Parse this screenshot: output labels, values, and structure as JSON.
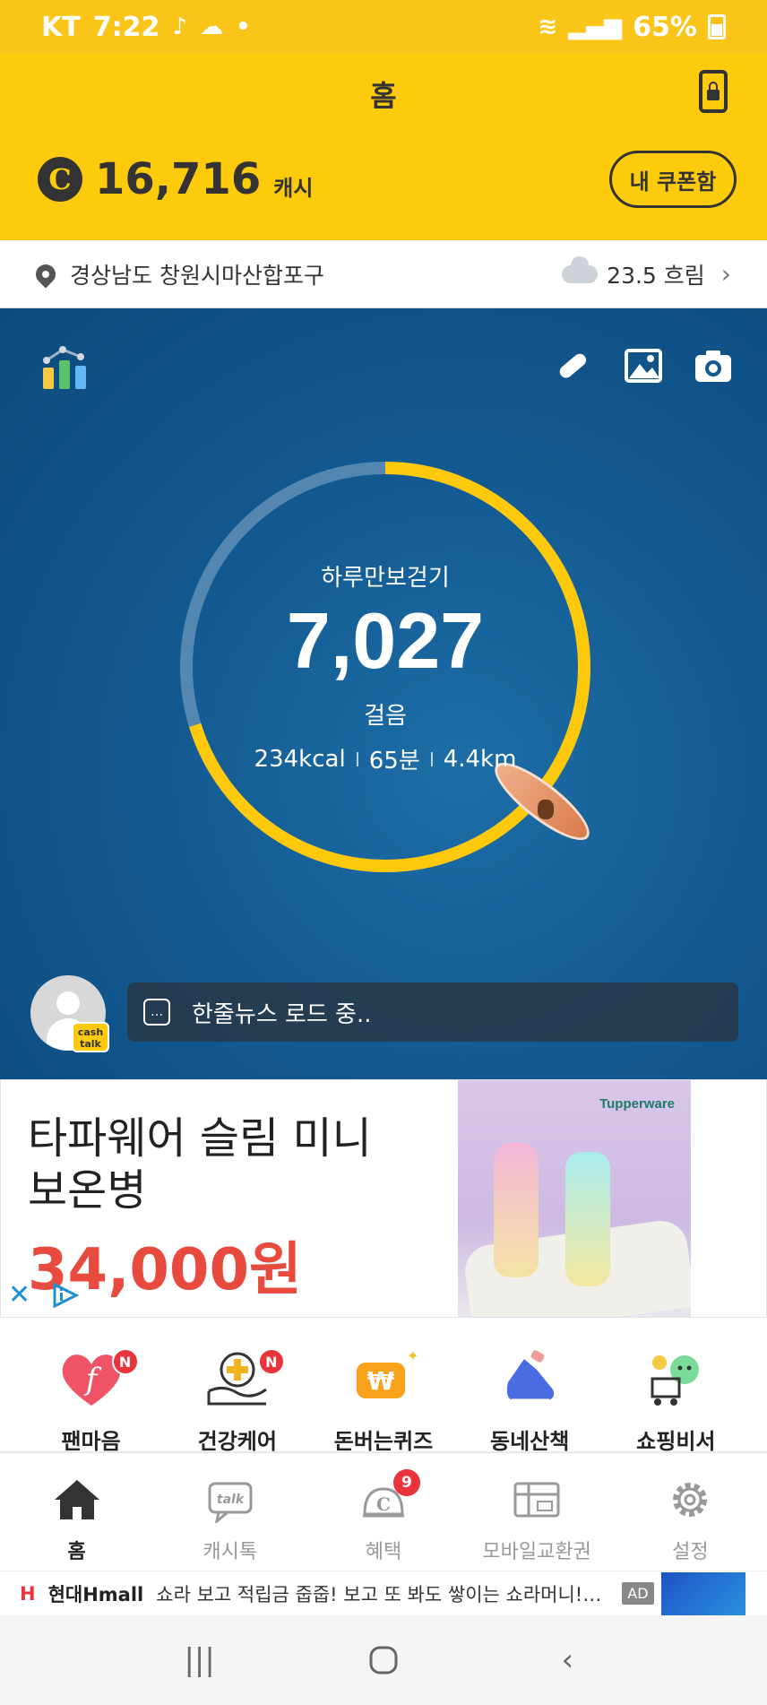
{
  "status_bar": {
    "carrier": "KT",
    "time": "7:22",
    "battery": "65%"
  },
  "header": {
    "title": "홈",
    "cash_amount": "16,716",
    "cash_unit": "캐시",
    "coupon_button": "내 쿠폰함",
    "coin_letter": "C"
  },
  "location": {
    "address": "경상남도 창원시마산합포구",
    "temperature_weather": "23.5 흐림"
  },
  "hero": {
    "title": "하루만보걷기",
    "steps": "7,027",
    "steps_unit": "걸음",
    "kcal": "234kcal",
    "minutes": "65분",
    "distance": "4.4km",
    "progress_fraction": 0.7027,
    "news_text": "한줄뉴스 로드 중..",
    "cashtalk_badge": "cash talk"
  },
  "ad": {
    "product_text": "타파웨어 슬림 미니 보온병",
    "price": "34,000원",
    "brand": "Tupperware"
  },
  "menu": {
    "items": [
      {
        "label": "팬마음",
        "badge": "N",
        "icon": "heart-f-icon"
      },
      {
        "label": "건강케어",
        "badge": "N",
        "icon": "health-care-icon"
      },
      {
        "label": "돈버는퀴즈",
        "badge": "",
        "icon": "quiz-icon"
      },
      {
        "label": "동네산책",
        "badge": "",
        "icon": "sneaker-icon"
      },
      {
        "label": "쇼핑비서",
        "badge": "",
        "icon": "shopping-assistant-icon"
      }
    ]
  },
  "bottom_nav": {
    "items": [
      {
        "label": "홈",
        "icon": "home-icon"
      },
      {
        "label": "캐시톡",
        "icon": "talk-icon"
      },
      {
        "label": "혜택",
        "icon": "benefit-icon",
        "badge": "9"
      },
      {
        "label": "모바일교환권",
        "icon": "gift-card-icon"
      },
      {
        "label": "설정",
        "icon": "gear-icon"
      }
    ]
  },
  "ad_strip": {
    "logo_letter": "H",
    "brand": "현대Hmall",
    "text": "쇼라 보고 적립금 줍줍! 보고 또 봐도 쌓이는 쇼라머니! 지...",
    "ad_label": "AD"
  },
  "colors": {
    "brand_yellow": "#fdcb0b",
    "ring_yellow": "#ffc90b",
    "badge_red": "#e8343a",
    "price_red": "#e84a3e"
  }
}
